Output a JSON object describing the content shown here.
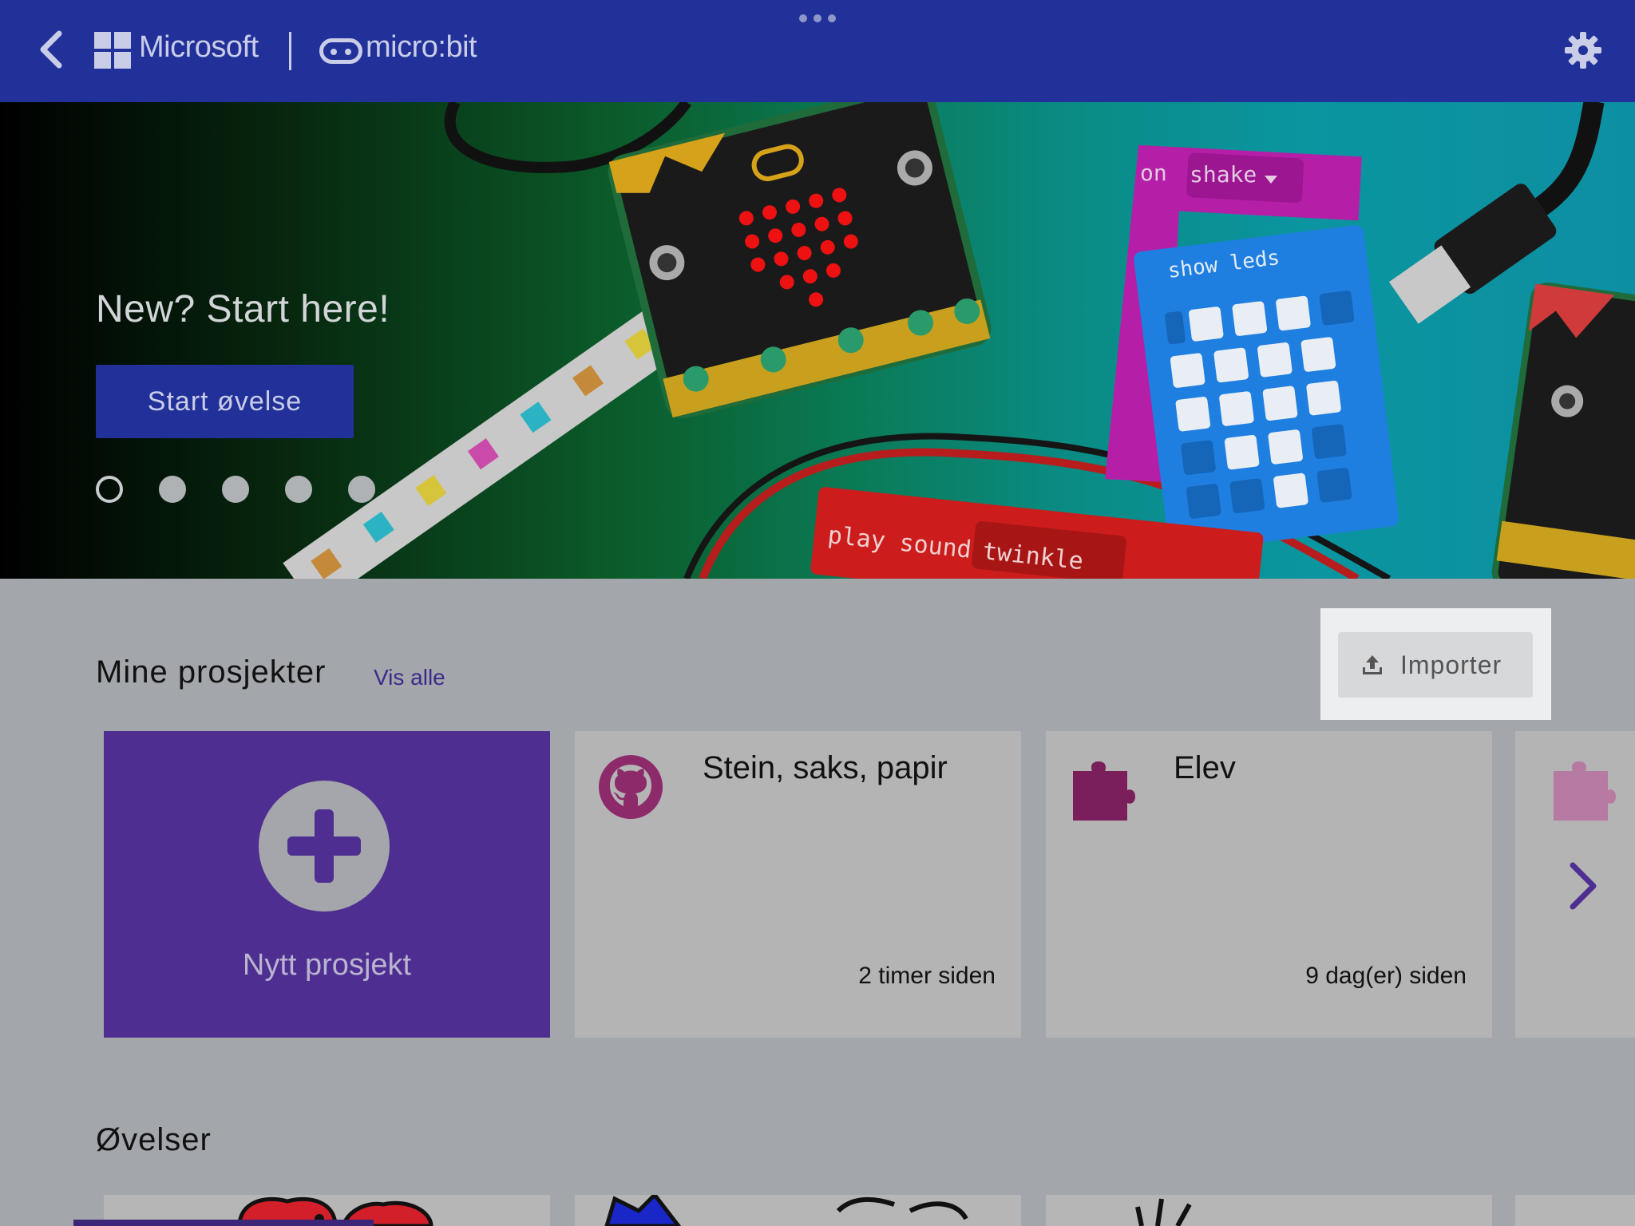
{
  "header": {
    "microsoft_label": "Microsoft",
    "microbit_label": "micro:bit",
    "icons": [
      "back-arrow-icon",
      "microsoft-logo-icon",
      "microbit-logo-icon",
      "gear-icon",
      "more-dots-icon"
    ]
  },
  "hero": {
    "title": "New? Start here!",
    "button_label": "Start øvelse",
    "carousel_slides": 5,
    "active_slide": 1,
    "illustration_text": {
      "event_block": "on",
      "event_value": "shake",
      "leds_block": "show leds",
      "sound_block": "play sound",
      "sound_value": "twinkle"
    }
  },
  "projects": {
    "section_title": "Mine prosjekter",
    "view_all": "Vis alle",
    "import_label": "Importer",
    "new_project_label": "Nytt prosjekt",
    "cards": [
      {
        "title": "Stein, saks, papir",
        "time": "2 timer siden",
        "icon": "github-icon"
      },
      {
        "title": "Elev",
        "time": "9 dag(er) siden",
        "icon": "puzzle-icon"
      }
    ]
  },
  "tutorials": {
    "section_title": "Øvelser"
  },
  "colors": {
    "header": "#22319a",
    "new_project": "#4e2f91",
    "accent_text": "#3b2a8a",
    "github_icon": "#8d2a6a",
    "puzzle_icon": "#7a1f5c"
  }
}
